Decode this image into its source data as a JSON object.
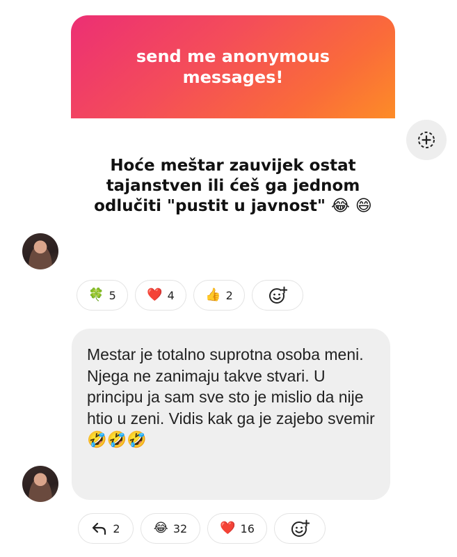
{
  "story": {
    "header": "send me anonymous messages!",
    "question": "Hoće meštar zauvijek ostat tajanstven ili ćeš ga jednom odlučiti \"pustit u javnost\" 😂 😄"
  },
  "reactions_1": [
    {
      "emoji": "🍀",
      "count": "5"
    },
    {
      "emoji": "❤️",
      "count": "4"
    },
    {
      "emoji": "👍",
      "count": "2"
    }
  ],
  "reply": {
    "text": "Mestar je totalno suprotna osoba meni. Njega ne zanimaju takve stvari. U principu ja sam sve sto je mislio da nije htio u zeni. Vidis kak ga je zajebo svemir 🤣🤣🤣"
  },
  "reactions_2": {
    "reply_count": "2",
    "items": [
      {
        "emoji": "😂",
        "count": "32"
      },
      {
        "emoji": "❤️",
        "count": "16"
      }
    ]
  },
  "icons": {
    "add": "circle-plus-icon",
    "add_reaction": "add-reaction-icon",
    "reply": "reply-arrow-icon"
  }
}
